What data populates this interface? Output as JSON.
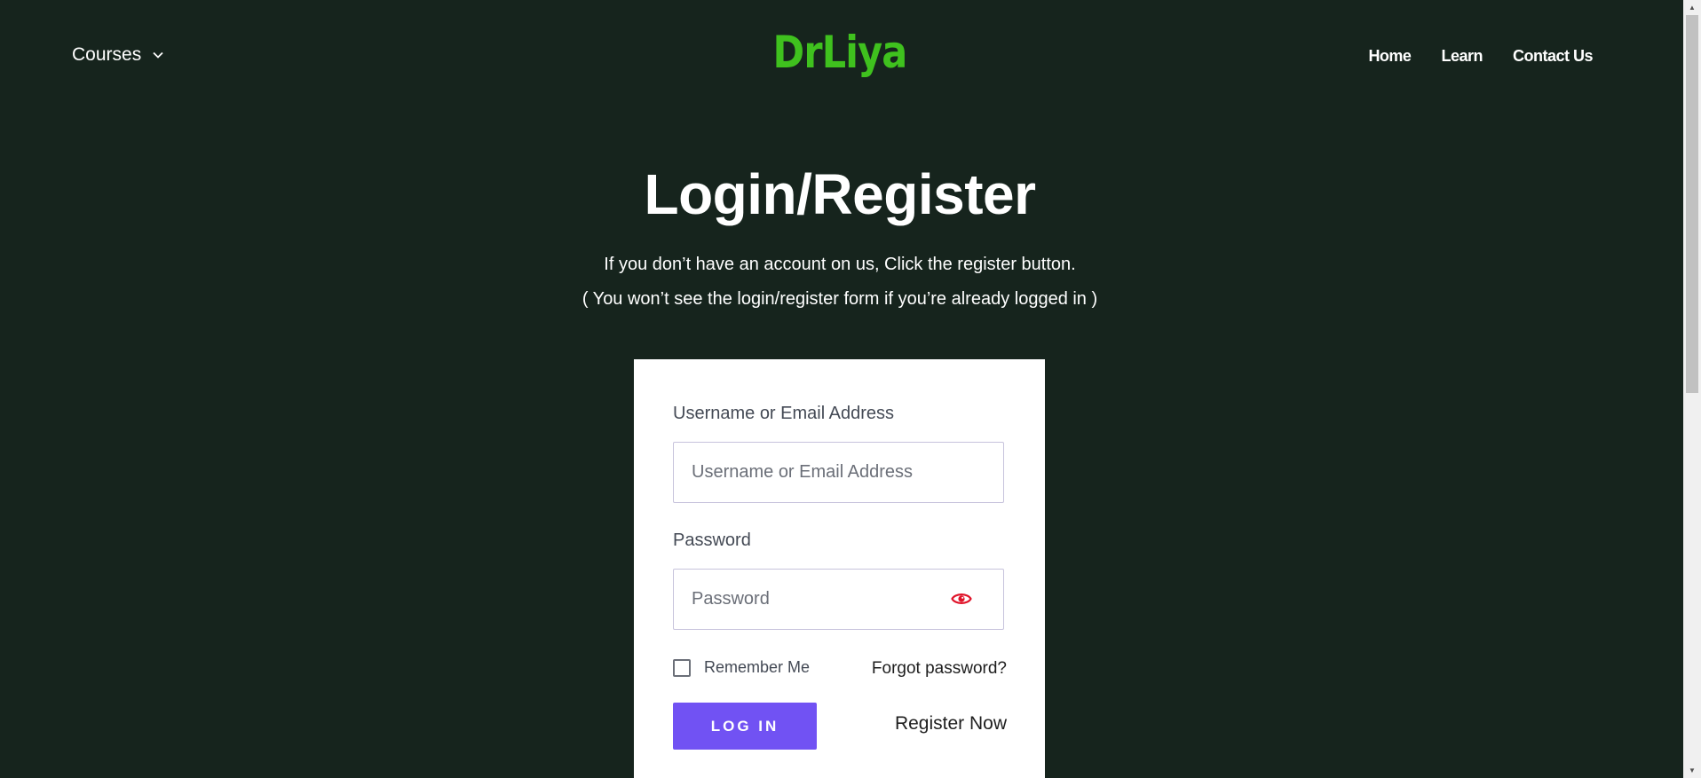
{
  "header": {
    "courses_label": "Courses",
    "logo_text": "DrLiya",
    "nav": {
      "home": "Home",
      "learn": "Learn",
      "contact": "Contact Us"
    }
  },
  "hero": {
    "title": "Login/Register",
    "subtitle_line1": "If you don’t have an account on us, Click the register button.",
    "subtitle_line2": "( You won’t see the login/register form if you’re already logged in )"
  },
  "login_form": {
    "username_label": "Username or Email Address",
    "username_placeholder": "Username or Email Address",
    "username_value": "",
    "password_label": "Password",
    "password_placeholder": "Password",
    "password_value": "",
    "remember_label": "Remember Me",
    "remember_checked": false,
    "forgot_label": "Forgot password?",
    "login_button": "LOG IN",
    "register_label": "Register Now"
  },
  "colors": {
    "background": "#16241d",
    "logo": "#3fc11e",
    "accent_button": "#7152f3",
    "eye_icon": "#e0142a"
  },
  "icons": {
    "courses_dropdown": "chevron-down-icon",
    "password_toggle": "eye-icon",
    "scroll_up": "scroll-up-arrow-icon",
    "scroll_down": "scroll-down-arrow-icon"
  }
}
